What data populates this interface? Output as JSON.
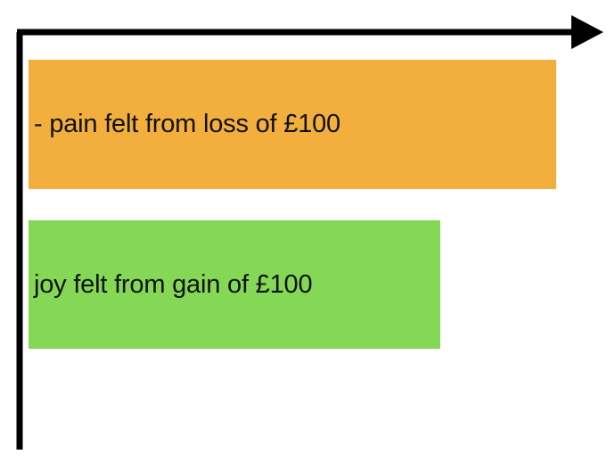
{
  "diagram": {
    "bars": [
      {
        "id": "loss",
        "label": "- pain felt from loss of £100",
        "color": "#F2AF3E"
      },
      {
        "id": "gain",
        "label": "joy felt from gain of £100",
        "color": "#84D856"
      }
    ],
    "axis_color": "#000000"
  }
}
